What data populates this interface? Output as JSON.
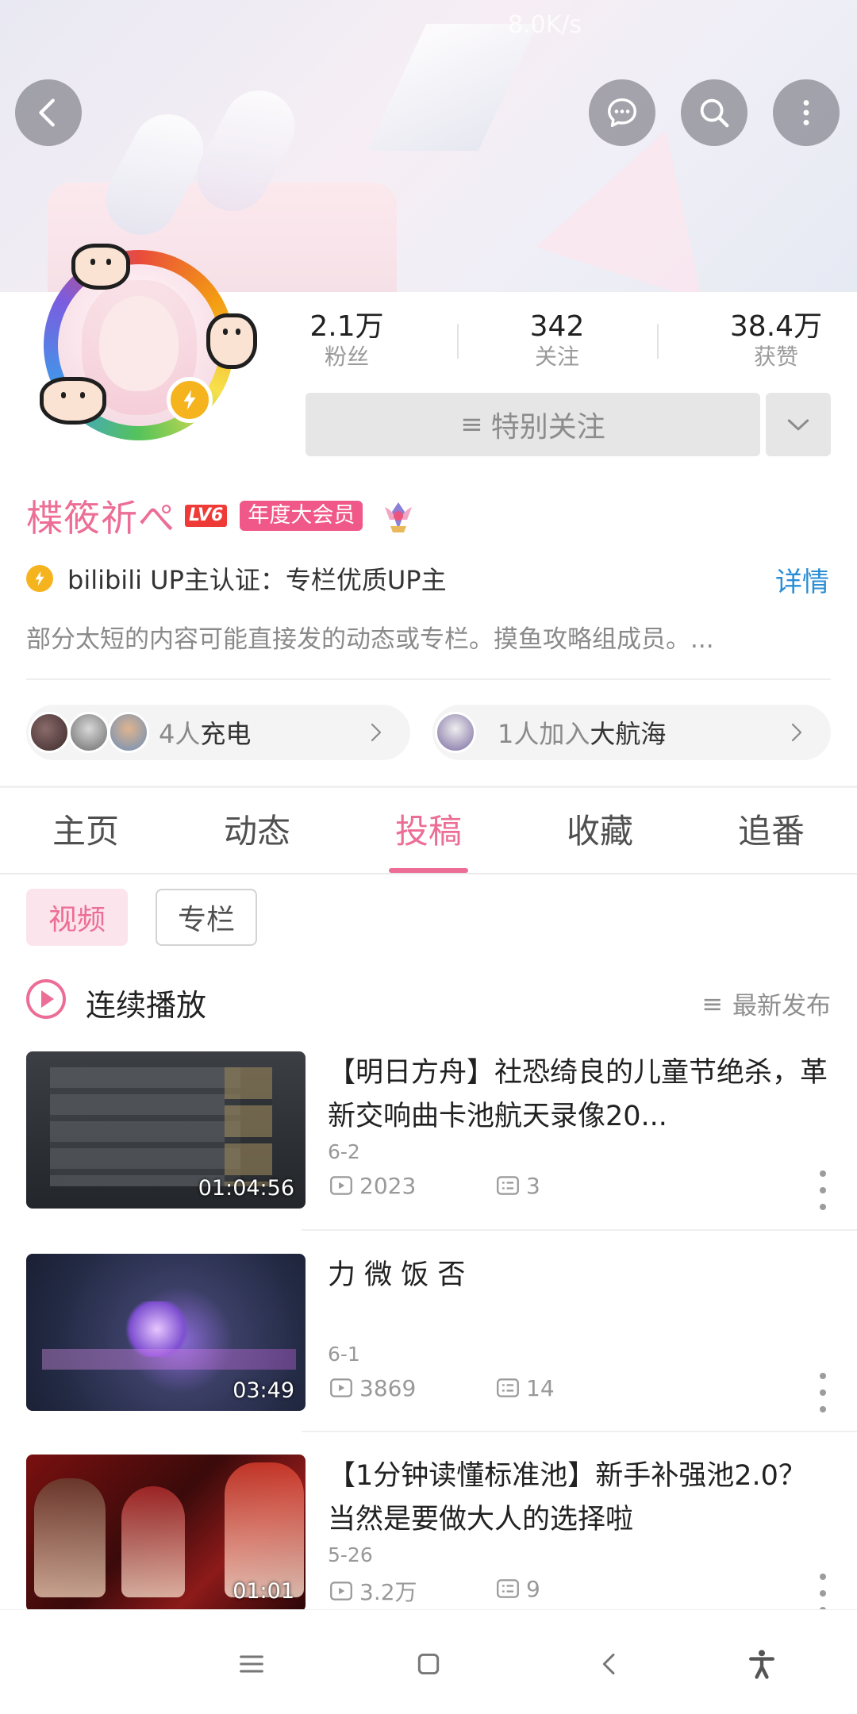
{
  "status_bar": {
    "speed": "8.0K/s"
  },
  "stats": [
    {
      "value": "2.1万",
      "label": "粉丝"
    },
    {
      "value": "342",
      "label": "关注"
    },
    {
      "value": "38.4万",
      "label": "获赞"
    }
  ],
  "follow_button": {
    "label": "特别关注"
  },
  "profile": {
    "name": "楪筱祈ぺ",
    "level": "LV6",
    "vip_badge": "年度大会员",
    "verification": "bilibili UP主认证：专栏优质UP主",
    "detail_link": "详情",
    "bio": "部分太短的内容可能直接发的动态或专栏。摸鱼攻略组成员。..."
  },
  "charge": {
    "count": "4人",
    "label": "充电"
  },
  "fleet": {
    "count": "1人加入",
    "label": "大航海"
  },
  "tabs": [
    "主页",
    "动态",
    "投稿",
    "收藏",
    "追番"
  ],
  "active_tab": "投稿",
  "content_filters": {
    "video": "视频",
    "column": "专栏"
  },
  "playlist": {
    "label": "连续播放",
    "sort": "最新发布"
  },
  "videos": [
    {
      "title": "【明日方舟】社恐绮良的儿童节绝杀，革新交响曲卡池航天录像20...",
      "date": "6-2",
      "duration": "01:04:56",
      "views": "2023",
      "comments": "3"
    },
    {
      "title": "力 微 饭 否",
      "date": "6-1",
      "duration": "03:49",
      "views": "3869",
      "comments": "14"
    },
    {
      "title": "【1分钟读懂标准池】新手补强池2.0？当然是要做大人的选择啦",
      "date": "5-26",
      "duration": "01:01",
      "views": "3.2万",
      "comments": "9"
    }
  ],
  "colors": {
    "accent_pink": "#ec6e96",
    "vip_pink": "#f0588a",
    "level_red": "#ef3b38",
    "link_blue": "#2a8ed4",
    "verify_yellow": "#f5b41e"
  },
  "icons": {
    "top_bar": [
      "back-icon",
      "chat-bubble-icon",
      "search-icon",
      "more-vertical-icon"
    ],
    "nav_bar": [
      "recent-apps-icon",
      "home-icon",
      "back-icon",
      "accessibility-icon"
    ]
  }
}
